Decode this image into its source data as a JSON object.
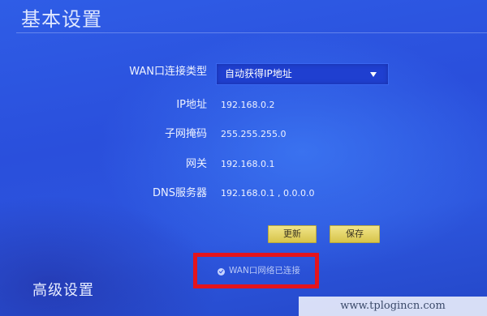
{
  "page": {
    "title": "基本设置",
    "advanced_title": "高级设置"
  },
  "form": {
    "wan_type": {
      "label": "WAN口连接类型",
      "value": "自动获得IP地址"
    },
    "ip": {
      "label": "IP地址",
      "value": "192.168.0.2"
    },
    "mask": {
      "label": "子网掩码",
      "value": "255.255.255.0"
    },
    "gateway": {
      "label": "网关",
      "value": "192.168.0.1"
    },
    "dns": {
      "label": "DNS服务器",
      "value": "192.168.0.1 , 0.0.0.0"
    }
  },
  "buttons": {
    "refresh": "更新",
    "save": "保存"
  },
  "status": {
    "text": "WAN口网络已连接",
    "icon": "check-circle-icon"
  },
  "watermark": "www.tplogincn.com",
  "colors": {
    "background": "#2a4fdc",
    "button": "#e5d66a",
    "highlight_box": "#e4141c"
  }
}
